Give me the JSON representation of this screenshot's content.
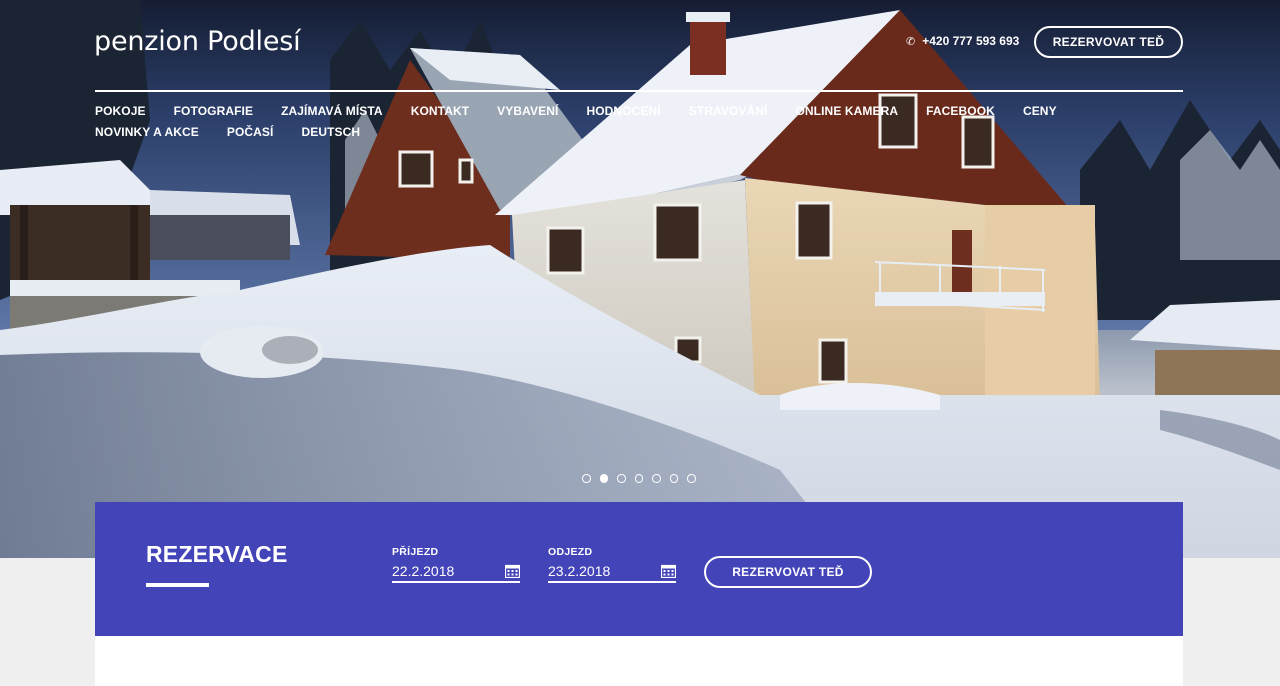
{
  "brand": {
    "logo": "penzion Podlesí"
  },
  "header": {
    "phone": "+420 777 593 693",
    "phone_icon": "phone-icon",
    "cta_label": "REZERVOVAT TEĎ"
  },
  "nav": {
    "items": [
      "POKOJE",
      "FOTOGRAFIE",
      "ZAJÍMAVÁ MÍSTA",
      "KONTAKT",
      "VYBAVENÍ",
      "HODNOCENÍ",
      "STRAVOVÁNÍ",
      "ONLINE KAMERA",
      "FACEBOOK",
      "CENY",
      "NOVINKY A AKCE",
      "POČASÍ",
      "DEUTSCH"
    ]
  },
  "slider": {
    "count": 7,
    "active_index": 1
  },
  "reservation": {
    "title": "REZERVACE",
    "arrival_label": "PŘÍJEZD",
    "arrival_value": "22.2.2018",
    "departure_label": "ODJEZD",
    "departure_value": "23.2.2018",
    "submit_label": "REZERVOVAT TEĎ",
    "calendar_icon": "calendar-icon"
  },
  "colors": {
    "reservation_bg": "#4444b9",
    "text": "#ffffff",
    "page_bg": "#efefef"
  }
}
